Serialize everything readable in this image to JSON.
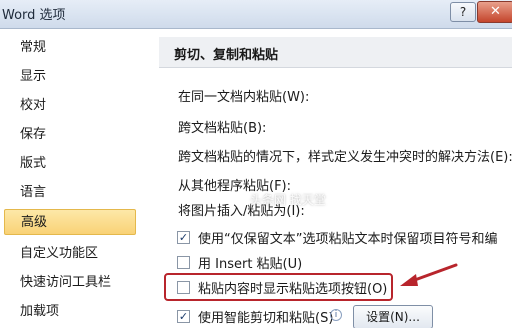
{
  "window": {
    "title": "Word 选项",
    "help_label": "?",
    "close_label": "✕"
  },
  "sidebar": {
    "items": [
      {
        "label": "常规"
      },
      {
        "label": "显示"
      },
      {
        "label": "校对"
      },
      {
        "label": "保存"
      },
      {
        "label": "版式"
      },
      {
        "label": "语言"
      },
      {
        "label": "高级"
      },
      {
        "label": "自定义功能区"
      },
      {
        "label": "快速访问工具栏"
      },
      {
        "label": "加载项"
      }
    ],
    "active_index": 6
  },
  "main": {
    "section_title": "剪切、复制和粘贴",
    "settings": [
      {
        "label": "在同一文档内粘贴(W):"
      },
      {
        "label": "跨文档粘贴(B):"
      },
      {
        "label": "跨文档粘贴的情况下，样式定义发生冲突时的解决方法(E):"
      },
      {
        "label": "从其他程序粘贴(F):"
      },
      {
        "label": "将图片插入/粘贴为(I):"
      }
    ],
    "checkboxes": [
      {
        "label": "使用“仅保留文本”选项粘贴文本时保留项目符号和编",
        "checked": true
      },
      {
        "label": "用 Insert 粘贴(U)",
        "checked": false
      },
      {
        "label": "粘贴内容时显示粘贴选项按钮(O)",
        "checked": false
      },
      {
        "label": "使用智能剪切和粘贴(S)",
        "checked": true
      }
    ],
    "settings_button": "设置(N)...",
    "info_icon": "i",
    "watermark": "头条网 找天堂"
  },
  "colors": {
    "highlight_border": "#b8252c",
    "arrow": "#b8252c",
    "active_nav": "#f9d276"
  }
}
